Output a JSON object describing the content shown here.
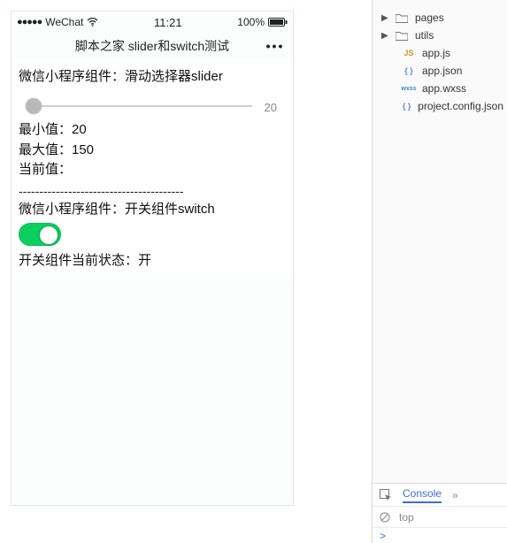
{
  "statusbar": {
    "carrier": "WeChat",
    "time": "11:21",
    "battery": "100%"
  },
  "navbar": {
    "title": "脚本之家 slider和switch测试",
    "more": "•••"
  },
  "content": {
    "slider_heading": "微信小程序组件：滑动选择器slider",
    "slider_value": "20",
    "min_label": "最小值：20",
    "max_label": "最大值：150",
    "cur_label": "当前值：",
    "divider": "----------------------------------------",
    "switch_heading": "微信小程序组件：开关组件switch",
    "switch_state_label": "开关组件当前状态：开"
  },
  "tree": {
    "folders": [
      {
        "name": "pages"
      },
      {
        "name": "utils"
      }
    ],
    "files": [
      {
        "icon": "js",
        "name": "app.js"
      },
      {
        "icon": "json",
        "name": "app.json"
      },
      {
        "icon": "wxss",
        "name": "app.wxss"
      },
      {
        "icon": "json",
        "name": "project.config.json"
      }
    ]
  },
  "console": {
    "tab": "Console",
    "filter": "top",
    "prompt": ">"
  }
}
